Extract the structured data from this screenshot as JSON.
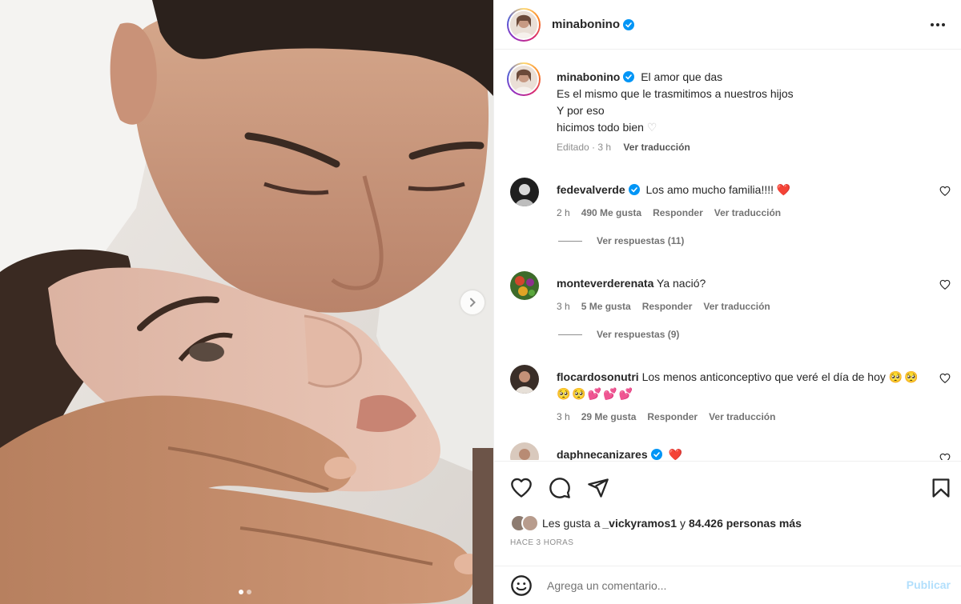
{
  "post": {
    "author": "minabonino",
    "author_verified": true,
    "more_icon": "more-horizontal-icon",
    "caption_lines": [
      "El amor que das",
      "Es el mismo que le trasmitimos a nuestros hijos",
      "Y por eso",
      "hicimos todo bien"
    ],
    "caption_emoji": "♡",
    "edited_label": "Editado",
    "caption_time": "3 h",
    "translate_label": "Ver traducción",
    "media_dots": 2,
    "media_active_dot": 0
  },
  "comments": [
    {
      "username": "fedevalverde",
      "verified": true,
      "text": "Los amo mucho familia!!!! ",
      "emoji": "❤️",
      "time": "2 h",
      "likes": "490 Me gusta",
      "reply": "Responder",
      "translate": "Ver traducción",
      "replies": "Ver respuestas (11)"
    },
    {
      "username": "monteverderenata",
      "verified": false,
      "text": "Ya nació?",
      "emoji": "",
      "time": "3 h",
      "likes": "5 Me gusta",
      "reply": "Responder",
      "translate": "Ver traducción",
      "replies": "Ver respuestas (9)"
    },
    {
      "username": "flocardosonutri",
      "verified": false,
      "text": "Los menos anticonceptivo que veré el día de hoy ",
      "emoji": "🥺🥺🥺🥺💕💕💕",
      "time": "3 h",
      "likes": "29 Me gusta",
      "reply": "Responder",
      "translate": "Ver traducción",
      "replies": ""
    },
    {
      "username": "daphnecanizares",
      "verified": true,
      "text": "",
      "emoji": "❤️",
      "time": "",
      "likes": "",
      "reply": "",
      "translate": "",
      "replies": ""
    }
  ],
  "actions": {
    "like_icon": "heart-icon",
    "comment_icon": "comment-icon",
    "share_icon": "send-icon",
    "save_icon": "bookmark-icon"
  },
  "likes": {
    "prefix": "Les gusta a ",
    "user": "_vickyramos1",
    "middle": " y ",
    "count": "84.426 personas más"
  },
  "time_ago": "HACE 3 HORAS",
  "add_comment": {
    "placeholder": "Agrega un comentario...",
    "post_label": "Publicar",
    "emoji_icon": "smiley-icon"
  },
  "colors": {
    "verified_blue": "#0095f6",
    "heart_red": "#ed4956",
    "publish_disabled": "#b2dffc",
    "meta_gray": "#737373"
  }
}
